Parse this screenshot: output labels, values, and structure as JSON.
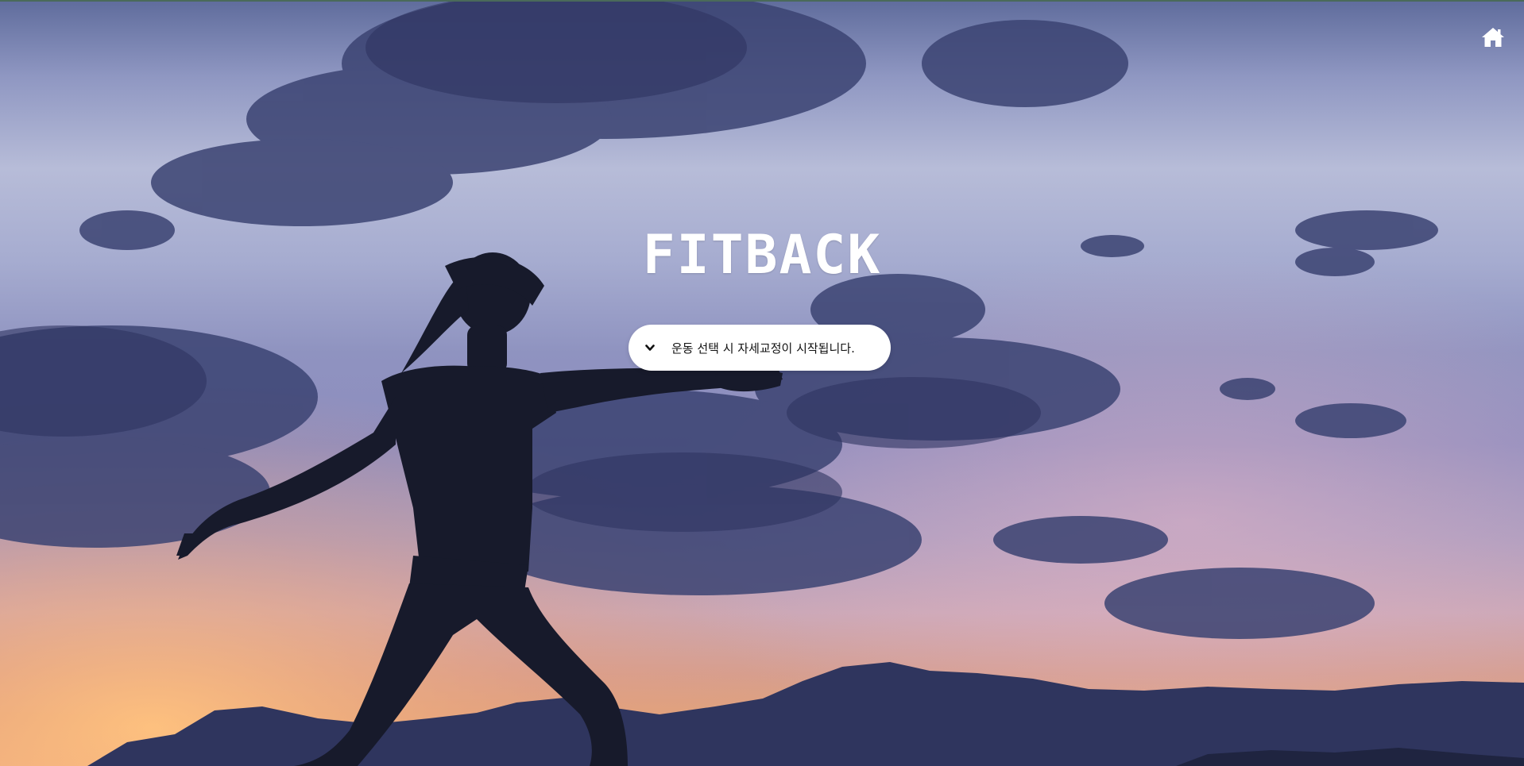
{
  "header": {
    "home_icon": "home-icon"
  },
  "hero": {
    "title": "FITBACK"
  },
  "exercise_select": {
    "icon": "chevron-down-icon",
    "selected_text": "운동 선택 시 자세교정이 시작됩니다."
  },
  "colors": {
    "title": "#ffffff",
    "select_background": "#ffffff",
    "select_text": "#111111"
  }
}
